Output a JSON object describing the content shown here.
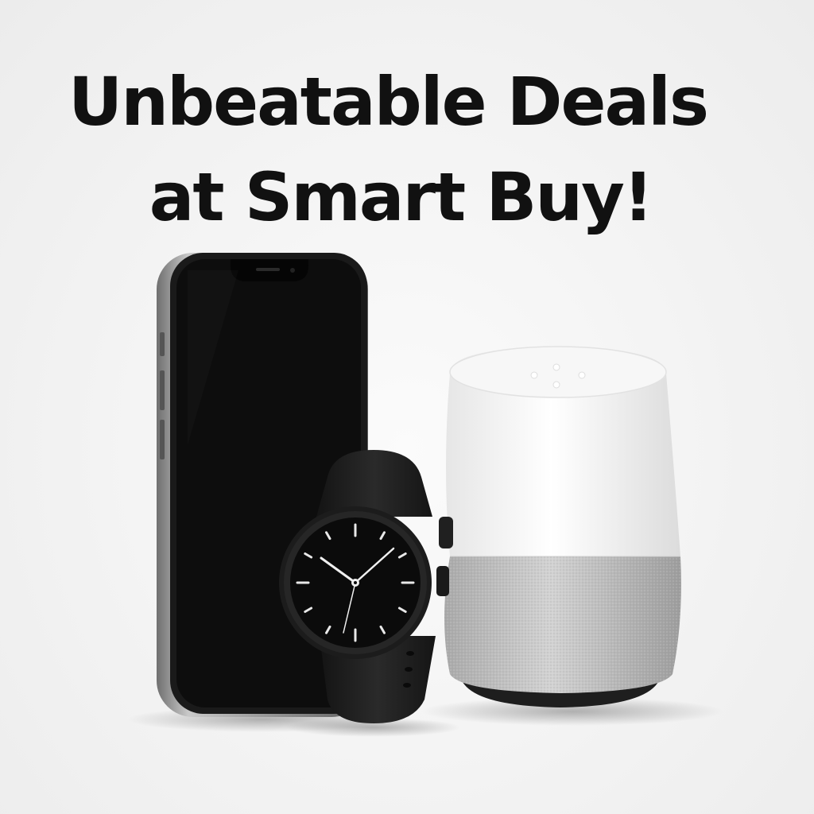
{
  "headline": {
    "line1": "Unbeatable Deals",
    "line2": "at Smart Buy!"
  },
  "products": [
    {
      "icon": "smartphone-icon"
    },
    {
      "icon": "smartwatch-icon"
    },
    {
      "icon": "smart-speaker-icon"
    }
  ],
  "colors": {
    "background": "#f4f4f4",
    "text": "#111111",
    "phone_screen": "#0d0d0d",
    "phone_frame": "#8a8a8a",
    "watch": "#1b1b1b",
    "speaker_top": "#fafafa",
    "speaker_fabric": "#bdbdbd",
    "speaker_base": "#222222"
  }
}
